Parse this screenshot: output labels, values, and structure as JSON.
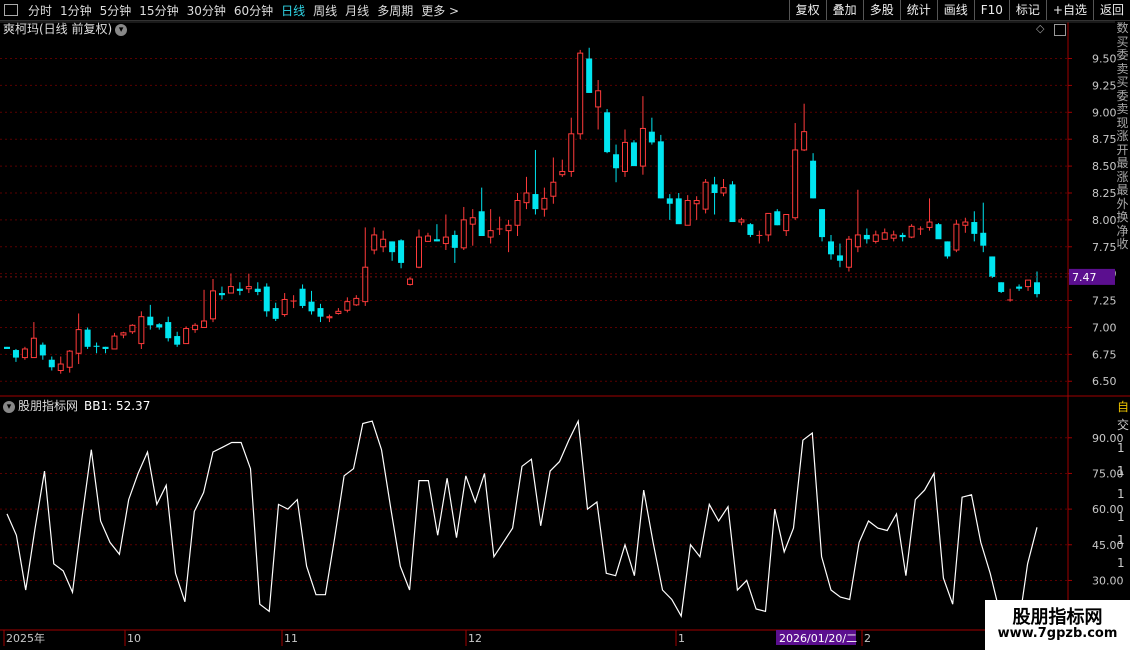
{
  "toolbar": {
    "periods": [
      "分时",
      "1分钟",
      "5分钟",
      "15分钟",
      "30分钟",
      "60分钟",
      "日线",
      "周线",
      "月线",
      "多周期",
      "更多 >"
    ],
    "active_period": "日线",
    "tools": [
      "复权",
      "叠加",
      "多股",
      "统计",
      "画线",
      "F10",
      "标记",
      "+自选",
      "返回"
    ]
  },
  "chart_title": "爽柯玛(日线 前复权)",
  "indicator_title": "股朋指标网",
  "indicator_value_text": "BB1: 52.37",
  "current_price_label": "7.47",
  "date_labels": [
    "2025年",
    "10",
    "11",
    "12",
    "1",
    "2"
  ],
  "cursor_date": "2026/01/20/二",
  "right_strip_chars": [
    "数",
    "买",
    "委",
    "卖",
    "买",
    "委",
    "卖",
    "现",
    "涨",
    "开",
    "最",
    "涨",
    "最",
    "外",
    "换",
    "净",
    "收"
  ],
  "ind_right_strip": [
    "自",
    "交",
    "1",
    "1",
    "1",
    "1",
    "1",
    "1"
  ],
  "watermark": {
    "line1": "股朋指标网",
    "line2": "www.7gpzb.com"
  },
  "colors": {
    "up": "#ff3b3b",
    "down": "#00e5f0",
    "axis": "#a10000",
    "grid": "#5a0000",
    "line": "#ffffff",
    "price_label_bg": "#5b0f8f"
  },
  "chart_data": [
    {
      "type": "candlestick",
      "title": "爽柯玛(日线 前复权)",
      "ylim": [
        6.4,
        9.7
      ],
      "y_ticks": [
        6.5,
        6.75,
        7.0,
        7.25,
        7.5,
        7.75,
        8.0,
        8.25,
        8.5,
        8.75,
        9.0,
        9.25,
        9.5
      ],
      "candles": [
        {
          "o": 6.82,
          "h": 6.82,
          "l": 6.8,
          "c": 6.8
        },
        {
          "o": 6.79,
          "h": 6.8,
          "l": 6.68,
          "c": 6.72
        },
        {
          "o": 6.72,
          "h": 6.82,
          "l": 6.7,
          "c": 6.8
        },
        {
          "o": 6.72,
          "h": 7.05,
          "l": 6.72,
          "c": 6.9
        },
        {
          "o": 6.84,
          "h": 6.86,
          "l": 6.7,
          "c": 6.74
        },
        {
          "o": 6.7,
          "h": 6.73,
          "l": 6.6,
          "c": 6.63
        },
        {
          "o": 6.6,
          "h": 6.73,
          "l": 6.57,
          "c": 6.66
        },
        {
          "o": 6.63,
          "h": 6.79,
          "l": 6.58,
          "c": 6.78
        },
        {
          "o": 6.76,
          "h": 7.13,
          "l": 6.66,
          "c": 6.98
        },
        {
          "o": 6.98,
          "h": 7.0,
          "l": 6.8,
          "c": 6.82
        },
        {
          "o": 6.83,
          "h": 6.86,
          "l": 6.76,
          "c": 6.82
        },
        {
          "o": 6.82,
          "h": 6.82,
          "l": 6.76,
          "c": 6.8
        },
        {
          "o": 6.8,
          "h": 6.95,
          "l": 6.8,
          "c": 6.92
        },
        {
          "o": 6.93,
          "h": 6.96,
          "l": 6.9,
          "c": 6.95
        },
        {
          "o": 6.96,
          "h": 7.03,
          "l": 6.94,
          "c": 7.02
        },
        {
          "o": 6.85,
          "h": 7.15,
          "l": 6.8,
          "c": 7.1
        },
        {
          "o": 7.1,
          "h": 7.21,
          "l": 6.98,
          "c": 7.02
        },
        {
          "o": 7.03,
          "h": 7.04,
          "l": 6.98,
          "c": 7.0
        },
        {
          "o": 7.05,
          "h": 7.1,
          "l": 6.87,
          "c": 6.9
        },
        {
          "o": 6.92,
          "h": 6.96,
          "l": 6.82,
          "c": 6.84
        },
        {
          "o": 6.85,
          "h": 7.01,
          "l": 6.85,
          "c": 6.99
        },
        {
          "o": 6.98,
          "h": 7.04,
          "l": 6.95,
          "c": 7.02
        },
        {
          "o": 7.0,
          "h": 7.35,
          "l": 7.0,
          "c": 7.06
        },
        {
          "o": 7.08,
          "h": 7.45,
          "l": 7.05,
          "c": 7.34
        },
        {
          "o": 7.32,
          "h": 7.38,
          "l": 7.26,
          "c": 7.3
        },
        {
          "o": 7.32,
          "h": 7.5,
          "l": 7.32,
          "c": 7.38
        },
        {
          "o": 7.36,
          "h": 7.42,
          "l": 7.3,
          "c": 7.34
        },
        {
          "o": 7.36,
          "h": 7.5,
          "l": 7.32,
          "c": 7.38
        },
        {
          "o": 7.36,
          "h": 7.42,
          "l": 7.3,
          "c": 7.33
        },
        {
          "o": 7.38,
          "h": 7.41,
          "l": 7.1,
          "c": 7.15
        },
        {
          "o": 7.18,
          "h": 7.23,
          "l": 7.06,
          "c": 7.08
        },
        {
          "o": 7.12,
          "h": 7.32,
          "l": 7.1,
          "c": 7.26
        },
        {
          "o": 7.25,
          "h": 7.3,
          "l": 7.18,
          "c": 7.25
        },
        {
          "o": 7.36,
          "h": 7.4,
          "l": 7.18,
          "c": 7.2
        },
        {
          "o": 7.24,
          "h": 7.34,
          "l": 7.12,
          "c": 7.15
        },
        {
          "o": 7.18,
          "h": 7.22,
          "l": 7.05,
          "c": 7.1
        },
        {
          "o": 7.09,
          "h": 7.12,
          "l": 7.05,
          "c": 7.1
        },
        {
          "o": 7.13,
          "h": 7.18,
          "l": 7.12,
          "c": 7.15
        },
        {
          "o": 7.16,
          "h": 7.28,
          "l": 7.14,
          "c": 7.24
        },
        {
          "o": 7.21,
          "h": 7.3,
          "l": 7.2,
          "c": 7.27
        },
        {
          "o": 7.24,
          "h": 7.93,
          "l": 7.2,
          "c": 7.56
        },
        {
          "o": 7.72,
          "h": 7.93,
          "l": 7.68,
          "c": 7.86
        },
        {
          "o": 7.75,
          "h": 7.9,
          "l": 7.7,
          "c": 7.82
        },
        {
          "o": 7.8,
          "h": 7.8,
          "l": 7.62,
          "c": 7.7
        },
        {
          "o": 7.81,
          "h": 7.82,
          "l": 7.55,
          "c": 7.6
        },
        {
          "o": 7.4,
          "h": 7.47,
          "l": 7.39,
          "c": 7.45
        },
        {
          "o": 7.56,
          "h": 7.91,
          "l": 7.55,
          "c": 7.84
        },
        {
          "o": 7.8,
          "h": 7.88,
          "l": 7.8,
          "c": 7.85
        },
        {
          "o": 7.82,
          "h": 7.96,
          "l": 7.8,
          "c": 7.8
        },
        {
          "o": 7.78,
          "h": 8.05,
          "l": 7.72,
          "c": 7.84
        },
        {
          "o": 7.86,
          "h": 7.9,
          "l": 7.6,
          "c": 7.74
        },
        {
          "o": 7.74,
          "h": 8.12,
          "l": 7.72,
          "c": 8.0
        },
        {
          "o": 7.96,
          "h": 8.1,
          "l": 7.76,
          "c": 8.02
        },
        {
          "o": 8.08,
          "h": 8.3,
          "l": 7.9,
          "c": 7.85
        },
        {
          "o": 7.84,
          "h": 8.1,
          "l": 7.78,
          "c": 7.9
        },
        {
          "o": 7.92,
          "h": 8.03,
          "l": 7.86,
          "c": 7.92
        },
        {
          "o": 7.9,
          "h": 8.0,
          "l": 7.7,
          "c": 7.95
        },
        {
          "o": 7.95,
          "h": 8.25,
          "l": 7.85,
          "c": 8.18
        },
        {
          "o": 8.16,
          "h": 8.4,
          "l": 8.1,
          "c": 8.25
        },
        {
          "o": 8.24,
          "h": 8.65,
          "l": 8.05,
          "c": 8.1
        },
        {
          "o": 8.1,
          "h": 8.3,
          "l": 8.03,
          "c": 8.2
        },
        {
          "o": 8.22,
          "h": 8.58,
          "l": 8.15,
          "c": 8.35
        },
        {
          "o": 8.42,
          "h": 8.56,
          "l": 8.4,
          "c": 8.45
        },
        {
          "o": 8.45,
          "h": 8.95,
          "l": 8.4,
          "c": 8.8
        },
        {
          "o": 8.8,
          "h": 9.58,
          "l": 8.75,
          "c": 9.55
        },
        {
          "o": 9.5,
          "h": 9.6,
          "l": 9.18,
          "c": 9.18
        },
        {
          "o": 9.05,
          "h": 9.3,
          "l": 8.84,
          "c": 9.2
        },
        {
          "o": 9.0,
          "h": 9.03,
          "l": 8.62,
          "c": 8.63
        },
        {
          "o": 8.61,
          "h": 8.7,
          "l": 8.35,
          "c": 8.48
        },
        {
          "o": 8.45,
          "h": 8.84,
          "l": 8.4,
          "c": 8.72
        },
        {
          "o": 8.72,
          "h": 8.74,
          "l": 8.5,
          "c": 8.5
        },
        {
          "o": 8.5,
          "h": 9.15,
          "l": 8.42,
          "c": 8.85
        },
        {
          "o": 8.82,
          "h": 8.95,
          "l": 8.7,
          "c": 8.72
        },
        {
          "o": 8.73,
          "h": 8.79,
          "l": 8.2,
          "c": 8.2
        },
        {
          "o": 8.2,
          "h": 8.24,
          "l": 8.0,
          "c": 8.15
        },
        {
          "o": 8.2,
          "h": 8.25,
          "l": 8.0,
          "c": 7.96
        },
        {
          "o": 7.95,
          "h": 8.23,
          "l": 7.95,
          "c": 8.18
        },
        {
          "o": 8.15,
          "h": 8.22,
          "l": 8.0,
          "c": 8.18
        },
        {
          "o": 8.1,
          "h": 8.38,
          "l": 8.06,
          "c": 8.35
        },
        {
          "o": 8.33,
          "h": 8.4,
          "l": 8.05,
          "c": 8.25
        },
        {
          "o": 8.25,
          "h": 8.38,
          "l": 8.22,
          "c": 8.3
        },
        {
          "o": 8.33,
          "h": 8.36,
          "l": 8.0,
          "c": 7.98
        },
        {
          "o": 7.98,
          "h": 8.02,
          "l": 7.95,
          "c": 8.0
        },
        {
          "o": 7.96,
          "h": 7.97,
          "l": 7.84,
          "c": 7.86
        },
        {
          "o": 7.86,
          "h": 7.9,
          "l": 7.78,
          "c": 7.86
        },
        {
          "o": 7.86,
          "h": 8.06,
          "l": 7.8,
          "c": 8.06
        },
        {
          "o": 8.08,
          "h": 8.1,
          "l": 7.95,
          "c": 7.95
        },
        {
          "o": 7.9,
          "h": 8.05,
          "l": 7.85,
          "c": 8.05
        },
        {
          "o": 8.02,
          "h": 8.9,
          "l": 8.0,
          "c": 8.65
        },
        {
          "o": 8.65,
          "h": 9.08,
          "l": 8.64,
          "c": 8.82
        },
        {
          "o": 8.55,
          "h": 8.62,
          "l": 8.2,
          "c": 8.2
        },
        {
          "o": 8.1,
          "h": 8.1,
          "l": 7.8,
          "c": 7.84
        },
        {
          "o": 7.8,
          "h": 7.86,
          "l": 7.63,
          "c": 7.68
        },
        {
          "o": 7.67,
          "h": 7.78,
          "l": 7.56,
          "c": 7.62
        },
        {
          "o": 7.56,
          "h": 7.85,
          "l": 7.52,
          "c": 7.82
        },
        {
          "o": 7.75,
          "h": 8.28,
          "l": 7.7,
          "c": 7.86
        },
        {
          "o": 7.86,
          "h": 7.92,
          "l": 7.78,
          "c": 7.82
        },
        {
          "o": 7.8,
          "h": 7.9,
          "l": 7.78,
          "c": 7.86
        },
        {
          "o": 7.82,
          "h": 7.92,
          "l": 7.82,
          "c": 7.88
        },
        {
          "o": 7.83,
          "h": 7.9,
          "l": 7.8,
          "c": 7.86
        },
        {
          "o": 7.86,
          "h": 7.88,
          "l": 7.8,
          "c": 7.84
        },
        {
          "o": 7.84,
          "h": 7.96,
          "l": 7.83,
          "c": 7.94
        },
        {
          "o": 7.92,
          "h": 7.94,
          "l": 7.86,
          "c": 7.92
        },
        {
          "o": 7.93,
          "h": 8.2,
          "l": 7.9,
          "c": 7.98
        },
        {
          "o": 7.96,
          "h": 7.97,
          "l": 7.84,
          "c": 7.82
        },
        {
          "o": 7.8,
          "h": 7.8,
          "l": 7.64,
          "c": 7.66
        },
        {
          "o": 7.72,
          "h": 8.0,
          "l": 7.7,
          "c": 7.96
        },
        {
          "o": 7.95,
          "h": 8.02,
          "l": 7.88,
          "c": 7.98
        },
        {
          "o": 7.98,
          "h": 8.08,
          "l": 7.8,
          "c": 7.87
        },
        {
          "o": 7.88,
          "h": 8.16,
          "l": 7.7,
          "c": 7.76
        },
        {
          "o": 7.66,
          "h": 7.66,
          "l": 7.46,
          "c": 7.47
        },
        {
          "o": 7.42,
          "h": 7.42,
          "l": 7.32,
          "c": 7.33
        },
        {
          "o": 7.26,
          "h": 7.36,
          "l": 7.24,
          "c": 7.26
        },
        {
          "o": 7.38,
          "h": 7.4,
          "l": 7.34,
          "c": 7.36
        },
        {
          "o": 7.38,
          "h": 7.43,
          "l": 7.34,
          "c": 7.44
        },
        {
          "o": 7.42,
          "h": 7.52,
          "l": 7.28,
          "c": 7.31
        }
      ]
    },
    {
      "type": "line",
      "title": "股朋指标网",
      "series": [
        {
          "name": "BB1",
          "values": [
            58,
            49,
            26,
            52,
            76,
            37,
            34,
            25,
            56,
            85,
            55,
            46,
            41,
            64,
            75,
            84,
            62,
            70,
            33,
            21,
            59,
            67,
            84,
            86,
            88,
            88,
            77,
            20,
            17,
            62,
            60,
            64,
            36,
            24,
            24,
            48,
            74,
            77,
            96,
            97,
            85,
            60,
            36,
            26,
            72,
            72,
            49,
            73,
            48,
            74,
            63,
            75,
            40,
            46,
            52,
            78,
            81,
            53,
            76,
            80,
            89,
            97,
            60,
            63,
            33,
            32,
            45,
            32,
            68,
            46,
            26,
            22,
            15,
            45,
            40,
            62,
            55,
            61,
            26,
            30,
            18,
            17,
            60,
            42,
            52,
            89,
            92,
            40,
            26,
            23,
            22,
            46,
            55,
            52,
            51,
            58,
            32,
            64,
            68,
            75,
            31,
            20,
            65,
            66,
            46,
            33,
            17,
            14,
            10,
            37,
            52.37
          ]
        }
      ],
      "ylim": [
        10,
        100
      ],
      "y_ticks": [
        30,
        45,
        60,
        75,
        90
      ]
    }
  ]
}
